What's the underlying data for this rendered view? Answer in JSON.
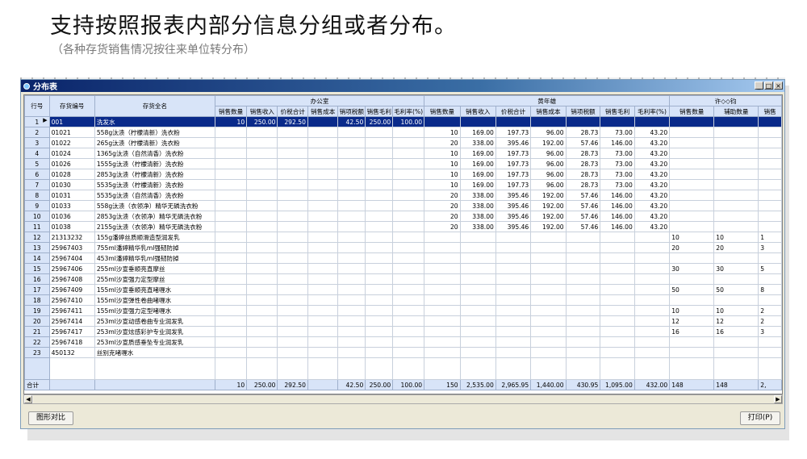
{
  "heading": "支持按照报表内部分信息分组或者分布。",
  "subheading": "（各种存货销售情况按往来单位转分布）",
  "window": {
    "title": "分布表",
    "min": "_",
    "max": "□",
    "close": "×"
  },
  "columns": {
    "row_no": "行号",
    "code": "存货编号",
    "name": "存货全名",
    "groups": [
      "办公室",
      "黄年雄",
      "许◇◇钧"
    ],
    "sub_a": [
      "销售数量",
      "销售收入",
      "价税合计",
      "销售成本",
      "销项税额",
      "销售毛利",
      "毛利率(%)"
    ],
    "sub_b": [
      "销售数量",
      "销售收入",
      "价税合计",
      "销售成本",
      "销项税额",
      "销售毛利",
      "毛利率(%)"
    ],
    "sub_c": [
      "销售数量",
      "辅助数量",
      "销售"
    ]
  },
  "rows": [
    {
      "no": "1",
      "code": "001",
      "name": "洗发水",
      "a": [
        "10",
        "250.00",
        "292.50",
        "",
        "42.50",
        "250.00",
        "100.00"
      ],
      "b": [
        "",
        "",
        "",
        "",
        "",
        "",
        ""
      ],
      "c": [
        "",
        "",
        ""
      ]
    },
    {
      "no": "2",
      "code": "01021",
      "name": "558g汰渍（柠檬清新）洗衣粉",
      "a": [
        "",
        "",
        "",
        "",
        "",
        "",
        ""
      ],
      "b": [
        "10",
        "169.00",
        "197.73",
        "96.00",
        "28.73",
        "73.00",
        "43.20"
      ],
      "c": [
        "",
        "",
        ""
      ]
    },
    {
      "no": "3",
      "code": "01022",
      "name": "265g汰渍（柠檬清新）洗衣粉",
      "a": [
        "",
        "",
        "",
        "",
        "",
        "",
        ""
      ],
      "b": [
        "20",
        "338.00",
        "395.46",
        "192.00",
        "57.46",
        "146.00",
        "43.20"
      ],
      "c": [
        "",
        "",
        ""
      ]
    },
    {
      "no": "4",
      "code": "01024",
      "name": "1365g汰渍（自然清香）洗衣粉",
      "a": [
        "",
        "",
        "",
        "",
        "",
        "",
        ""
      ],
      "b": [
        "10",
        "169.00",
        "197.73",
        "96.00",
        "28.73",
        "73.00",
        "43.20"
      ],
      "c": [
        "",
        "",
        ""
      ]
    },
    {
      "no": "5",
      "code": "01026",
      "name": "1555g汰渍（柠檬清新）洗衣粉",
      "a": [
        "",
        "",
        "",
        "",
        "",
        "",
        ""
      ],
      "b": [
        "10",
        "169.00",
        "197.73",
        "96.00",
        "28.73",
        "73.00",
        "43.20"
      ],
      "c": [
        "",
        "",
        ""
      ]
    },
    {
      "no": "6",
      "code": "01028",
      "name": "2853g汰渍（柠檬清新）洗衣粉",
      "a": [
        "",
        "",
        "",
        "",
        "",
        "",
        ""
      ],
      "b": [
        "10",
        "169.00",
        "197.73",
        "96.00",
        "28.73",
        "73.00",
        "43.20"
      ],
      "c": [
        "",
        "",
        ""
      ]
    },
    {
      "no": "7",
      "code": "01030",
      "name": "5535g汰渍（柠檬清新）洗衣粉",
      "a": [
        "",
        "",
        "",
        "",
        "",
        "",
        ""
      ],
      "b": [
        "10",
        "169.00",
        "197.73",
        "96.00",
        "28.73",
        "73.00",
        "43.20"
      ],
      "c": [
        "",
        "",
        ""
      ]
    },
    {
      "no": "8",
      "code": "01031",
      "name": "5535g汰渍（自然清香）洗衣粉",
      "a": [
        "",
        "",
        "",
        "",
        "",
        "",
        ""
      ],
      "b": [
        "20",
        "338.00",
        "395.46",
        "192.00",
        "57.46",
        "146.00",
        "43.20"
      ],
      "c": [
        "",
        "",
        ""
      ]
    },
    {
      "no": "9",
      "code": "01033",
      "name": "558g汰渍（衣领净）精华无磷洗衣粉",
      "a": [
        "",
        "",
        "",
        "",
        "",
        "",
        ""
      ],
      "b": [
        "20",
        "338.00",
        "395.46",
        "192.00",
        "57.46",
        "146.00",
        "43.20"
      ],
      "c": [
        "",
        "",
        ""
      ]
    },
    {
      "no": "10",
      "code": "01036",
      "name": "2853g汰渍（衣领净）精华无磷洗衣粉",
      "a": [
        "",
        "",
        "",
        "",
        "",
        "",
        ""
      ],
      "b": [
        "20",
        "338.00",
        "395.46",
        "192.00",
        "57.46",
        "146.00",
        "43.20"
      ],
      "c": [
        "",
        "",
        ""
      ]
    },
    {
      "no": "11",
      "code": "01038",
      "name": "2155g汰渍（衣领净）精华无磷洗衣粉",
      "a": [
        "",
        "",
        "",
        "",
        "",
        "",
        ""
      ],
      "b": [
        "20",
        "338.00",
        "395.46",
        "192.00",
        "57.46",
        "146.00",
        "43.20"
      ],
      "c": [
        "",
        "",
        ""
      ]
    },
    {
      "no": "12",
      "code": "21313232",
      "name": "155g潘婷丝质顺滑造型润发乳",
      "a": [
        "",
        "",
        "",
        "",
        "",
        "",
        ""
      ],
      "b": [
        "",
        "",
        "",
        "",
        "",
        "",
        ""
      ],
      "c": [
        "10",
        "10",
        "1"
      ]
    },
    {
      "no": "13",
      "code": "25967403",
      "name": "755ml潘婷精华乳ml强韧防掉",
      "a": [
        "",
        "",
        "",
        "",
        "",
        "",
        ""
      ],
      "b": [
        "",
        "",
        "",
        "",
        "",
        "",
        ""
      ],
      "c": [
        "20",
        "20",
        "3"
      ]
    },
    {
      "no": "14",
      "code": "25967404",
      "name": "453ml潘婷精华乳ml强韧防掉",
      "a": [
        "",
        "",
        "",
        "",
        "",
        "",
        ""
      ],
      "b": [
        "",
        "",
        "",
        "",
        "",
        "",
        ""
      ],
      "c": [
        "",
        "",
        ""
      ]
    },
    {
      "no": "15",
      "code": "25967406",
      "name": "255ml沙宣垂顺亮直摩丝",
      "a": [
        "",
        "",
        "",
        "",
        "",
        "",
        ""
      ],
      "b": [
        "",
        "",
        "",
        "",
        "",
        "",
        ""
      ],
      "c": [
        "30",
        "30",
        "5"
      ]
    },
    {
      "no": "16",
      "code": "25967408",
      "name": "255ml沙宣强力定型摩丝",
      "a": [
        "",
        "",
        "",
        "",
        "",
        "",
        ""
      ],
      "b": [
        "",
        "",
        "",
        "",
        "",
        "",
        ""
      ],
      "c": [
        "",
        "",
        ""
      ]
    },
    {
      "no": "17",
      "code": "25967409",
      "name": "155ml沙宣垂顺亮直啫喱水",
      "a": [
        "",
        "",
        "",
        "",
        "",
        "",
        ""
      ],
      "b": [
        "",
        "",
        "",
        "",
        "",
        "",
        ""
      ],
      "c": [
        "50",
        "50",
        "8"
      ]
    },
    {
      "no": "18",
      "code": "25967410",
      "name": "155ml沙宣弹性卷曲啫喱水",
      "a": [
        "",
        "",
        "",
        "",
        "",
        "",
        ""
      ],
      "b": [
        "",
        "",
        "",
        "",
        "",
        "",
        ""
      ],
      "c": [
        "",
        "",
        ""
      ]
    },
    {
      "no": "19",
      "code": "25967411",
      "name": "155ml沙宣强力定型啫喱水",
      "a": [
        "",
        "",
        "",
        "",
        "",
        "",
        ""
      ],
      "b": [
        "",
        "",
        "",
        "",
        "",
        "",
        ""
      ],
      "c": [
        "10",
        "10",
        "2"
      ]
    },
    {
      "no": "20",
      "code": "25967414",
      "name": "253ml沙宣动感卷曲专业润发乳",
      "a": [
        "",
        "",
        "",
        "",
        "",
        "",
        ""
      ],
      "b": [
        "",
        "",
        "",
        "",
        "",
        "",
        ""
      ],
      "c": [
        "12",
        "12",
        "2"
      ]
    },
    {
      "no": "21",
      "code": "25967417",
      "name": "253ml沙宣炫感彩护专业润发乳",
      "a": [
        "",
        "",
        "",
        "",
        "",
        "",
        ""
      ],
      "b": [
        "",
        "",
        "",
        "",
        "",
        "",
        ""
      ],
      "c": [
        "16",
        "16",
        "3"
      ]
    },
    {
      "no": "22",
      "code": "25967418",
      "name": "253ml沙宣质感垂坠专业润发乳",
      "a": [
        "",
        "",
        "",
        "",
        "",
        "",
        ""
      ],
      "b": [
        "",
        "",
        "",
        "",
        "",
        "",
        ""
      ],
      "c": [
        "",
        "",
        ""
      ]
    },
    {
      "no": "23",
      "code": "450132",
      "name": "丝别克啫喱水",
      "a": [
        "",
        "",
        "",
        "",
        "",
        "",
        ""
      ],
      "b": [
        "",
        "",
        "",
        "",
        "",
        "",
        ""
      ],
      "c": [
        "",
        "",
        ""
      ]
    }
  ],
  "total": {
    "label": "合计",
    "a": [
      "10",
      "250.00",
      "292.50",
      "",
      "42.50",
      "250.00",
      "100.00"
    ],
    "b": [
      "150",
      "2,535.00",
      "2,965.95",
      "1,440.00",
      "430.95",
      "1,095.00",
      "432.00"
    ],
    "c": [
      "148",
      "148",
      "2,"
    ]
  },
  "scroll": {
    "left": "◀",
    "right": "▶"
  },
  "buttons": {
    "compare": "图形对比",
    "print": "打印(P)"
  }
}
